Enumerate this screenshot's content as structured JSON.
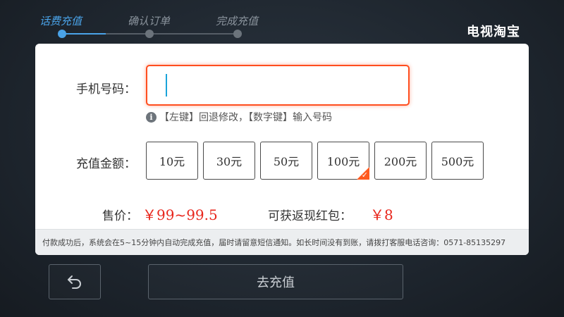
{
  "steps": [
    {
      "label": "话费充值",
      "active": true
    },
    {
      "label": "确认订单",
      "active": false
    },
    {
      "label": "完成充值",
      "active": false
    }
  ],
  "brand": "电视淘宝",
  "form": {
    "phone_label": "手机号码：",
    "phone_value": "",
    "hint_icon": "info-icon",
    "hint_text": "【左键】回退修改，【数字键】输入号码",
    "amount_label": "充值金额：",
    "amounts": [
      "10元",
      "30元",
      "50元",
      "100元",
      "200元",
      "500元"
    ],
    "selected_amount": "100元",
    "price_label": "售价：",
    "price_value": "￥99~99.5",
    "cashback_label": "可获返现红包：",
    "cashback_value": "￥8"
  },
  "notice": "付款成功后，系统会在5~15分钟内自动完成充值，届时请留意短信通知。如长时间没有到账，请拨打客服电话咨询：0571-85135297",
  "buttons": {
    "back_icon": "back-arrow-icon",
    "submit_label": "去充值"
  },
  "colors": {
    "accent": "#4aa3e8",
    "input_border": "#ff4e1f",
    "price": "#e8261c",
    "selected_corner": "#ff5a1f"
  }
}
